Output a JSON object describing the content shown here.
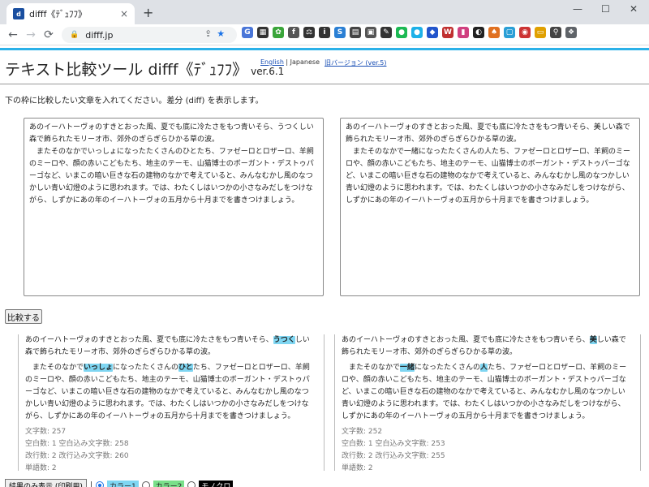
{
  "browser": {
    "tab_title": "difff《ﾃﾞｭﾌﾌ》",
    "favicon": "d",
    "close": "×",
    "new_tab": "+",
    "url": "difff.jp",
    "win_min": "—",
    "win_max": "☐",
    "win_close": "✕",
    "icons": [
      "back-icon",
      "forward-icon",
      "reload-icon",
      "lock-icon",
      "share-icon",
      "bookmark-star-icon"
    ],
    "extensions": [
      {
        "label": "G",
        "color": "#4a76d8"
      },
      {
        "label": "▦",
        "color": "#333333"
      },
      {
        "label": "✿",
        "color": "#3aa53a"
      },
      {
        "label": "f",
        "color": "#555555"
      },
      {
        "label": "⚖",
        "color": "#333333"
      },
      {
        "label": "i",
        "color": "#333333"
      },
      {
        "label": "S",
        "color": "#2a7fd4"
      },
      {
        "label": "▤",
        "color": "#444444"
      },
      {
        "label": "▣",
        "color": "#555555"
      },
      {
        "label": "✎",
        "color": "#333333"
      },
      {
        "label": "●",
        "color": "#1db954"
      },
      {
        "label": "●",
        "color": "#1db1e8"
      },
      {
        "label": "◆",
        "color": "#2255cc"
      },
      {
        "label": "W",
        "color": "#c03030"
      },
      {
        "label": "▮",
        "color": "#d04080"
      },
      {
        "label": "◐",
        "color": "#222222"
      },
      {
        "label": "♠",
        "color": "#e07020"
      },
      {
        "label": "▢",
        "color": "#2a9fd6"
      },
      {
        "label": "◉",
        "color": "#cc3333"
      },
      {
        "label": "▭",
        "color": "#e0a000"
      },
      {
        "label": "⚲",
        "color": "#444444"
      },
      {
        "label": "❖",
        "color": "#5f6368"
      }
    ],
    "off_badge": "OFF",
    "badge_count": "4"
  },
  "header": {
    "title": "テキスト比較ツール difff《ﾃﾞｭﾌﾌ》",
    "version": "ver.6.1",
    "lang_en": "English",
    "lang_sep": " | ",
    "lang_ja": "Japanese",
    "old_version": "旧バージョン (ver.5)"
  },
  "intro": "下の枠に比較したい文章を入れてください。差分 (diff) を表示します。",
  "inputs": {
    "left": "あのイーハトーヴォのすきとおった風、夏でも底に冷たさをもつ青いそら、うつくしい森で飾られたモリーオ市、郊外のぎらぎらひかる草の波。\n　またそのなかでいっしょになったたくさんのひとたち、ファゼーロとロザーロ、羊飼のミーロや、顔の赤いこどもたち、地主のテーモ、山猫博士のボーガント・デストゥパーゴなど、いまこの暗い巨きな石の建物のなかで考えていると、みんなむかし風のなつかしい青い幻燈のように思われます。では、わたくしはいつかの小さなみだしをつけながら、しずかにあの年のイーハトーヴォの五月から十月までを書きつけましょう。",
    "right": "あのイーハトーヴォのすきとおった風、夏でも底に冷たさをもつ青いそら、美しい森で飾られたモリーオ市、郊外のぎらぎらひかる草の波。\n　またそのなかで一緒になったたくさんの人たち、ファゼーロとロザーロ、羊飼のミーロや、顔の赤いこどもたち、地主のテーモ、山猫博士のボーガント・デストゥパーゴなど、いまこの暗い巨きな石の建物のなかで考えていると、みんなむかし風のなつかしい青い幻燈のように思われます。では、わたくしはいつかの小さなみだしをつけながら、しずかにあの年のイーハトーヴォの五月から十月までを書きつけましょう。"
  },
  "compare_button": "比較する",
  "results": {
    "left": {
      "p1_a": "あのイーハトーヴォのすきとおった風、夏でも底に冷たさをもつ青いそら、",
      "p1_hl": "うつく",
      "p1_b": "しい森で飾られたモリーオ市、郊外のぎらぎらひかる草の波。",
      "p2_a": "　またそのなかで",
      "p2_hl1": "いっしょ",
      "p2_b": "になったたくさんの",
      "p2_hl2": "ひと",
      "p2_c": "たち、ファゼーロとロザーロ、羊飼のミーロや、顔の赤いこどもたち、地主のテーモ、山猫博士のボーガント・デストゥパーゴなど、いまこの暗い巨きな石の建物のなかで考えていると、みんなむかし風のなつかしい青い幻燈のように思われます。では、わたくしはいつかの小さなみだしをつけながら、しずかにあの年のイーハトーヴォの五月から十月までを書きつけましょう。",
      "stat_chars": "文字数: 257",
      "stat_spaces": "空白数: 1 空白込み文字数: 258",
      "stat_lines": "改行数: 2 改行込み文字数: 260",
      "stat_words": "単語数: 2"
    },
    "right": {
      "p1_a": "あのイーハトーヴォのすきとおった風、夏でも底に冷たさをもつ青いそら、",
      "p1_hl": "美",
      "p1_b": "しい森で飾られたモリーオ市、郊外のぎらぎらひかる草の波。",
      "p2_a": "　またそのなかで",
      "p2_hl1": "一緒",
      "p2_b": "になったたくさんの",
      "p2_hl2": "人",
      "p2_c": "たち、ファゼーロとロザーロ、羊飼のミーロや、顔の赤いこどもたち、地主のテーモ、山猫博士のボーガント・デストゥパーゴなど、いまこの暗い巨きな石の建物のなかで考えていると、みんなむかし風のなつかしい青い幻燈のように思われます。では、わたくしはいつかの小さなみだしをつけながら、しずかにあの年のイーハトーヴォの五月から十月までを書きつけましょう。",
      "stat_chars": "文字数: 252",
      "stat_spaces": "空白数: 1 空白込み文字数: 253",
      "stat_lines": "改行数: 2 改行込み文字数: 255",
      "stat_words": "単語数: 2"
    }
  },
  "bottom": {
    "print_button": "結果のみ表示 (印刷用)",
    "sep": "|",
    "color1": "カラー1",
    "color2": "カラー2",
    "color3": "モノクロ"
  }
}
